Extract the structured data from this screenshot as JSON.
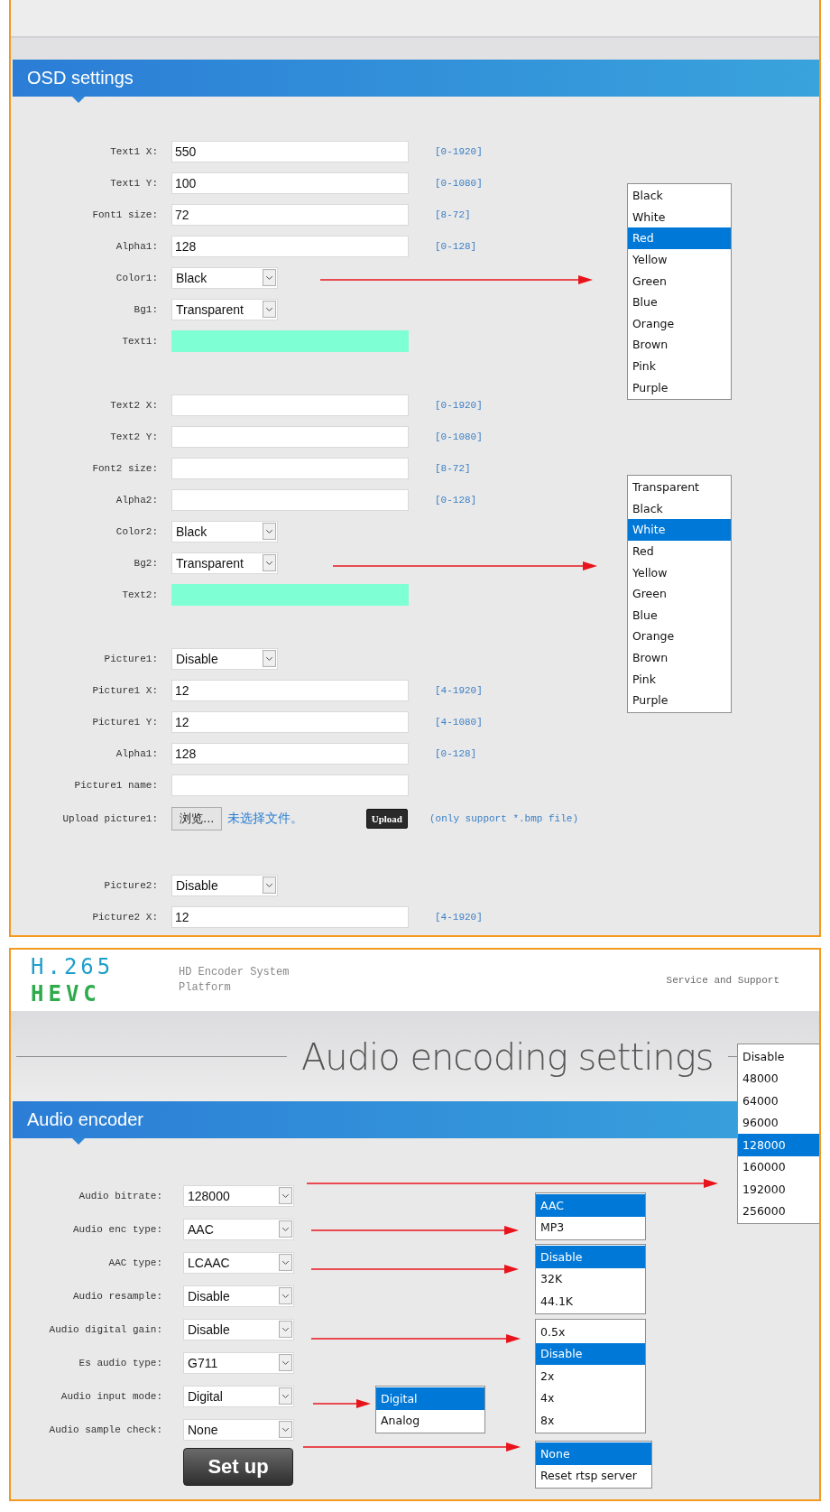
{
  "osd_panel": {
    "title": "OSD settings",
    "groups": [
      [
        {
          "kind": "input",
          "label": "Text1 X:",
          "value": "550",
          "range": "[0-1920]"
        },
        {
          "kind": "input",
          "label": "Text1 Y:",
          "value": "100",
          "range": "[0-1080]"
        },
        {
          "kind": "input",
          "label": "Font1 size:",
          "value": "72",
          "range": "[8-72]"
        },
        {
          "kind": "input",
          "label": "Alpha1:",
          "value": "128",
          "range": "[0-128]"
        },
        {
          "kind": "select",
          "label": "Color1:",
          "value": "Black"
        },
        {
          "kind": "select",
          "label": "Bg1:",
          "value": "Transparent"
        },
        {
          "kind": "text-color",
          "label": "Text1:"
        }
      ],
      [
        {
          "kind": "input",
          "label": "Text2 X:",
          "range": "[0-1920]"
        },
        {
          "kind": "input",
          "label": "Text2 Y:",
          "range": "[0-1080]"
        },
        {
          "kind": "input",
          "label": "Font2 size:",
          "range": "[8-72]"
        },
        {
          "kind": "input",
          "label": "Alpha2:",
          "range": "[0-128]"
        },
        {
          "kind": "select",
          "label": "Color2:",
          "value": "Black"
        },
        {
          "kind": "select",
          "label": "Bg2:",
          "value": "Transparent"
        },
        {
          "kind": "text-color",
          "label": "Text2:"
        }
      ],
      [
        {
          "kind": "select",
          "label": "Picture1:",
          "value": "Disable"
        },
        {
          "kind": "input",
          "label": "Picture1 X:",
          "value": "12",
          "range": "[4-1920]"
        },
        {
          "kind": "input",
          "label": "Picture1 Y:",
          "value": "12",
          "range": "[4-1080]"
        },
        {
          "kind": "input",
          "label": "Alpha1:",
          "value": "128",
          "range": "[0-128]"
        },
        {
          "kind": "input",
          "label": "Picture1 name:"
        },
        {
          "kind": "upload",
          "label": "Upload picture1:",
          "browse": "浏览...",
          "status": "未选择文件。",
          "button": "Upload",
          "note": "(only support *.bmp file)"
        }
      ],
      [
        {
          "kind": "select",
          "label": "Picture2:",
          "value": "Disable"
        },
        {
          "kind": "input",
          "label": "Picture2 X:",
          "value": "12",
          "range": "[4-1920]"
        }
      ]
    ],
    "option_lists": [
      {
        "options": [
          {
            "label": "Black",
            "selected": false
          },
          {
            "label": "White",
            "selected": false
          },
          {
            "label": "Red",
            "selected": true
          },
          {
            "label": "Yellow",
            "selected": false
          },
          {
            "label": "Green",
            "selected": false
          },
          {
            "label": "Blue",
            "selected": false
          },
          {
            "label": "Orange",
            "selected": false
          },
          {
            "label": "Brown",
            "selected": false
          },
          {
            "label": "Pink",
            "selected": false
          },
          {
            "label": "Purple",
            "selected": false
          }
        ]
      },
      {
        "options": [
          {
            "label": "Transparent",
            "selected": false
          },
          {
            "label": "Black",
            "selected": false
          },
          {
            "label": "White",
            "selected": true
          },
          {
            "label": "Red",
            "selected": false
          },
          {
            "label": "Yellow",
            "selected": false
          },
          {
            "label": "Green",
            "selected": false
          },
          {
            "label": "Blue",
            "selected": false
          },
          {
            "label": "Orange",
            "selected": false
          },
          {
            "label": "Brown",
            "selected": false
          },
          {
            "label": "Pink",
            "selected": false
          },
          {
            "label": "Purple",
            "selected": false
          }
        ]
      }
    ]
  },
  "audio_panel": {
    "logo": [
      "H.265",
      "HEVC"
    ],
    "platform": "HD Encoder System Platform",
    "support_link": "Service and Support",
    "page_title": "Audio encoding settings",
    "section_title": "Audio encoder",
    "fields": [
      {
        "label": "Audio bitrate:",
        "value": "128000"
      },
      {
        "label": "Audio enc type:",
        "value": "AAC"
      },
      {
        "label": "AAC type:",
        "value": "LCAAC"
      },
      {
        "label": "Audio resample:",
        "value": "Disable"
      },
      {
        "label": "Audio digital gain:",
        "value": "Disable"
      },
      {
        "label": "Es audio type:",
        "value": "G711"
      },
      {
        "label": "Audio input mode:",
        "value": "Digital"
      },
      {
        "label": "Audio sample check:",
        "value": "None"
      }
    ],
    "submit_button": "Set up",
    "option_lists": [
      {
        "options": [
          {
            "label": "Disable",
            "selected": false
          },
          {
            "label": "48000",
            "selected": false
          },
          {
            "label": "64000",
            "selected": false
          },
          {
            "label": "96000",
            "selected": false
          },
          {
            "label": "128000",
            "selected": true
          },
          {
            "label": "160000",
            "selected": false
          },
          {
            "label": "192000",
            "selected": false
          },
          {
            "label": "256000",
            "selected": false
          }
        ]
      },
      {
        "options": [
          {
            "label": "AAC",
            "selected": true
          },
          {
            "label": "MP3",
            "selected": false
          }
        ]
      },
      {
        "options": [
          {
            "label": "Disable",
            "selected": true
          },
          {
            "label": "32K",
            "selected": false
          },
          {
            "label": "44.1K",
            "selected": false
          }
        ]
      },
      {
        "options": [
          {
            "label": "Digital",
            "selected": true
          },
          {
            "label": "Analog",
            "selected": false
          }
        ]
      },
      {
        "options": [
          {
            "label": "0.5x",
            "selected": false
          },
          {
            "label": "Disable",
            "selected": true
          },
          {
            "label": "2x",
            "selected": false
          },
          {
            "label": "4x",
            "selected": false
          },
          {
            "label": "8x",
            "selected": false
          }
        ]
      },
      {
        "options": [
          {
            "label": "None",
            "selected": true
          },
          {
            "label": "Reset rtsp server",
            "selected": false
          }
        ]
      }
    ]
  }
}
